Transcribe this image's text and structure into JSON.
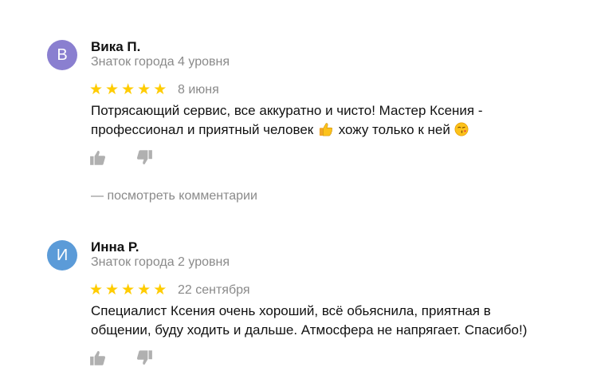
{
  "reviews": [
    {
      "avatar_letter": "В",
      "avatar_color": "#8a7fd0",
      "name": "Вика П.",
      "level": "Знаток города 4 уровня",
      "rating": 5,
      "date": "8 июня",
      "text_line1": "Потрясающий сервис, все аккуратно и чисто! Мастер Ксения -",
      "text_line2a": "профессионал и приятный человек",
      "text_line2b": "хожу только к ней",
      "emoji_1": "thumbs-up-emoji",
      "emoji_2": "kiss-emoji",
      "comments_link": "— посмотреть комментарии"
    },
    {
      "avatar_letter": "И",
      "avatar_color": "#5b9bd8",
      "name": "Инна Р.",
      "level": "Знаток города 2 уровня",
      "rating": 5,
      "date": "22 сентября",
      "text_line1": "Специалист Ксения очень хороший, всё обьяснила, приятная в",
      "text_line2": "общении, буду ходить и дальше. Атмосфера не напрягает. Спасибо!)"
    }
  ],
  "colors": {
    "star": "#ffcc00",
    "muted_text": "#8a8a8a",
    "reaction_icon": "#b0b0b0"
  },
  "icons": [
    "like-icon",
    "dislike-icon",
    "star-icon"
  ]
}
